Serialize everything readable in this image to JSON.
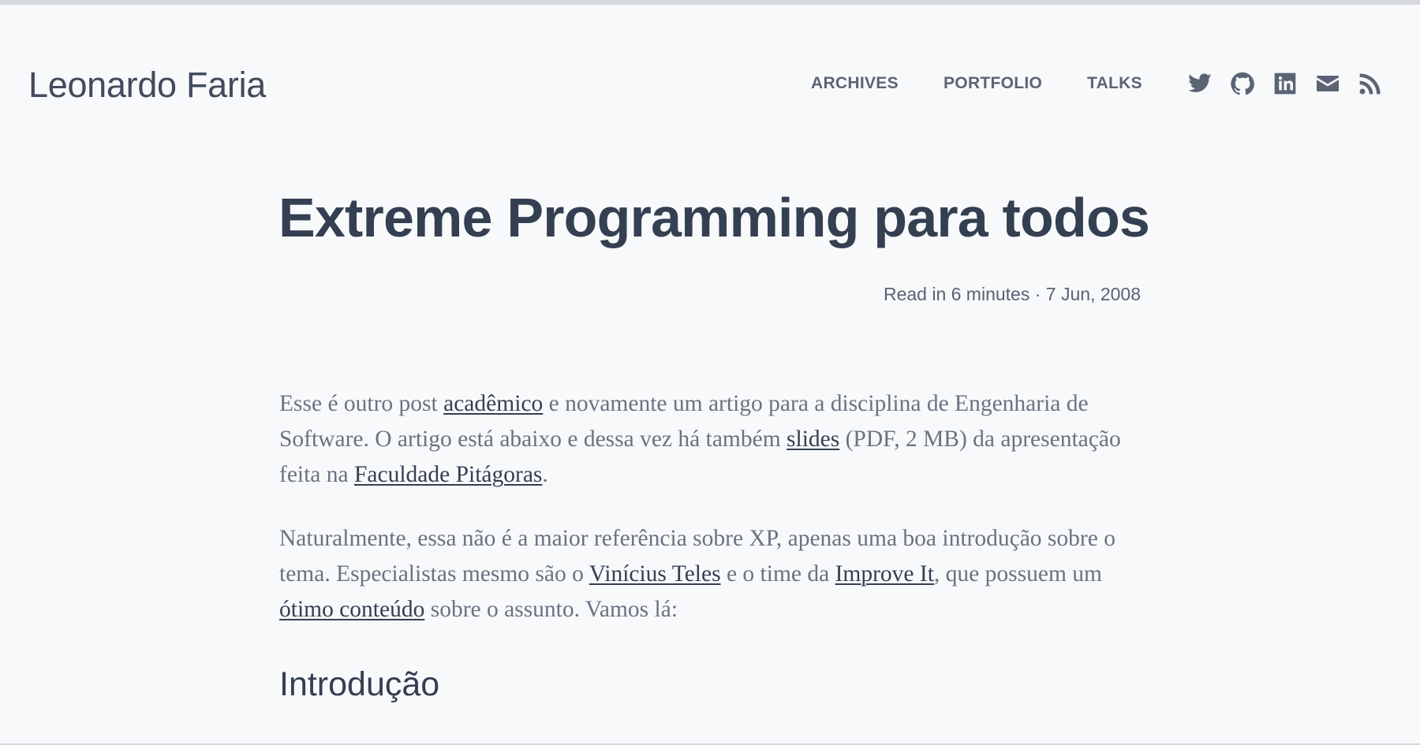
{
  "header": {
    "site_title": "Leonardo Faria",
    "nav": [
      {
        "label": "ARCHIVES"
      },
      {
        "label": "PORTFOLIO"
      },
      {
        "label": "TALKS"
      }
    ],
    "social_icons": [
      "twitter-icon",
      "github-icon",
      "linkedin-icon",
      "email-icon",
      "rss-icon"
    ],
    "icon_color": "#5b6474"
  },
  "post": {
    "title": "Extreme Programming para todos",
    "meta": "Read in 6 minutes · 7 Jun, 2008",
    "p1": {
      "t1": "Esse é outro post ",
      "link1": "acadêmico",
      "t2": " e novamente um artigo para a disciplina de Engenharia de Software. O artigo está abaixo e dessa vez há também ",
      "link2": "slides",
      "t3": " (PDF, 2 MB) da apresentação feita na ",
      "link3": "Faculdade Pitágoras",
      "t4": "."
    },
    "p2": {
      "t1": "Naturalmente, essa não é a maior referência sobre XP, apenas uma boa introdução sobre o tema. Especialistas mesmo são o ",
      "link1": "Vinícius Teles",
      "t2": " e o time da ",
      "link2": "Improve It",
      "t3": ", que possuem um ",
      "link3": "ótimo conteúdo",
      "t4": " sobre o assunto. Vamos lá:"
    },
    "section_heading": "Introdução"
  },
  "colors": {
    "background": "#f8f9fb",
    "heading": "#353f52",
    "body_text": "#6b7280",
    "link": "#353f52"
  }
}
